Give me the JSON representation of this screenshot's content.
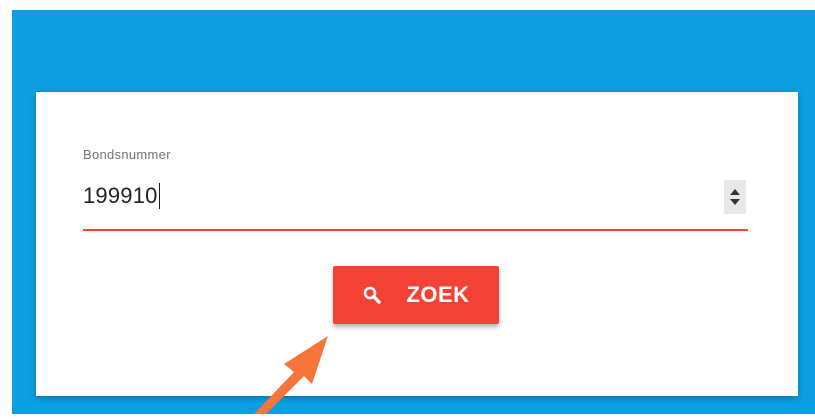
{
  "form": {
    "field_label": "Bondsnummer",
    "field_value": "199910"
  },
  "search_button": {
    "label": "ZOEK",
    "icon": "search-icon"
  },
  "annotation": {
    "icon": "arrow-pointer-icon"
  },
  "colors": {
    "background": "#0d9fe2",
    "accent": "#f44336",
    "annotation_arrow": "#f7743a"
  }
}
